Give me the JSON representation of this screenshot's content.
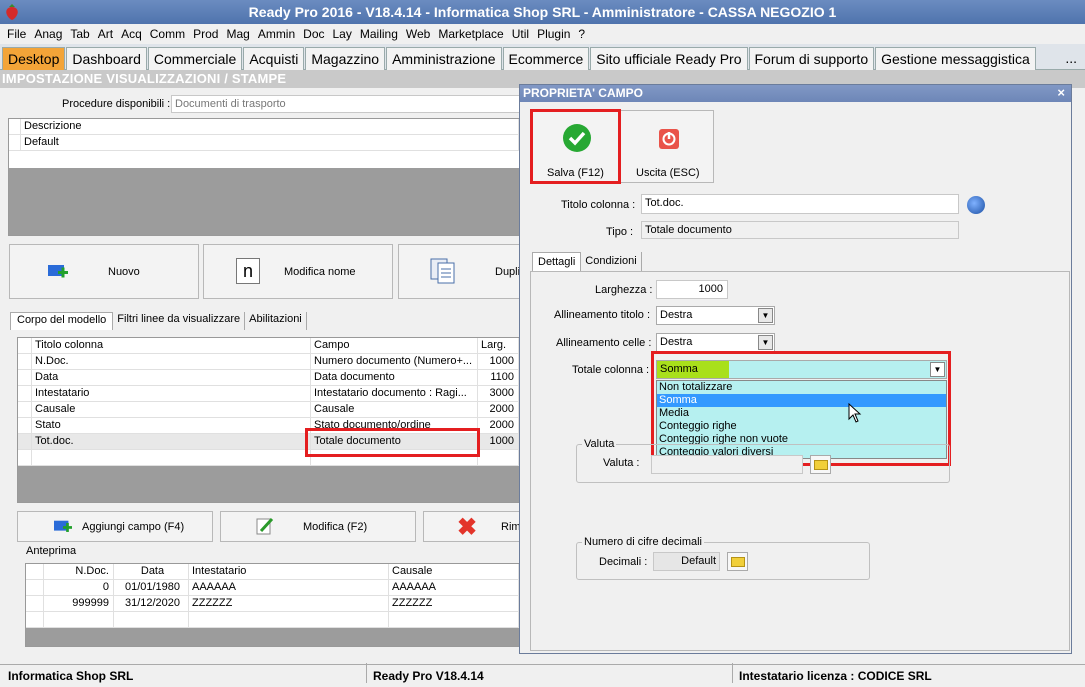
{
  "window": {
    "title": "Ready Pro 2016 - V18.4.14 - Informatica Shop SRL - Amministratore - CASSA NEGOZIO 1"
  },
  "menu": [
    "File",
    "Anag",
    "Tab",
    "Art",
    "Acq",
    "Comm",
    "Prod",
    "Mag",
    "Ammin",
    "Doc",
    "Lay",
    "Mailing",
    "Web",
    "Marketplace",
    "Util",
    "Plugin",
    "?"
  ],
  "tabs": [
    "Desktop",
    "Dashboard",
    "Commerciale",
    "Acquisti",
    "Magazzino",
    "Amministrazione",
    "Ecommerce",
    "Sito ufficiale Ready Pro",
    "Forum di supporto",
    "Gestione messaggistica"
  ],
  "tab_more": "...",
  "section_title": "IMPOSTAZIONE VISUALIZZAZIONI / STAMPE",
  "procedure": {
    "label": "Procedure disponibili :",
    "value": "Documenti di trasporto"
  },
  "models": {
    "header": "Descrizione",
    "rows": [
      "Default"
    ]
  },
  "model_buttons": {
    "new": "Nuovo",
    "rename": "Modifica nome",
    "duplicate": "Dupli"
  },
  "subtabs": [
    "Corpo del modello",
    "Filtri linee da visualizzare",
    "Abilitazioni"
  ],
  "columns_grid": {
    "headers": [
      "Titolo colonna",
      "Campo",
      "Larg."
    ],
    "rows": [
      [
        "N.Doc.",
        "Numero documento (Numero+...",
        "1000"
      ],
      [
        "Data",
        "Data documento",
        "1100"
      ],
      [
        "Intestatario",
        "Intestatario documento : Ragi...",
        "3000"
      ],
      [
        "Causale",
        "Causale",
        "2000"
      ],
      [
        "Stato",
        "Stato documento/ordine",
        "2000"
      ],
      [
        "Tot.doc.",
        "Totale documento",
        "1000"
      ]
    ]
  },
  "field_buttons": {
    "add": "Aggiungi campo (F4)",
    "edit": "Modifica (F2)",
    "remove": "Rimu"
  },
  "preview": {
    "label": "Anteprima",
    "headers": [
      "N.Doc.",
      "Data",
      "Intestatario",
      "Causale"
    ],
    "rows": [
      [
        "0",
        "01/01/1980",
        "AAAAAA",
        "AAAAAA"
      ],
      [
        "999999",
        "31/12/2020",
        "ZZZZZZ",
        "ZZZZZZ"
      ]
    ]
  },
  "dialog": {
    "title": "PROPRIETA' CAMPO",
    "close": "×",
    "save_label": "Salva (F12)",
    "exit_label": "Uscita (ESC)",
    "titolo_label": "Titolo colonna :",
    "titolo_value": "Tot.doc.",
    "tipo_label": "Tipo :",
    "tipo_value": "Totale documento",
    "tabs": [
      "Dettagli",
      "Condizioni"
    ],
    "larghezza_label": "Larghezza :",
    "larghezza_value": "1000",
    "allin_titolo_label": "Allineamento titolo :",
    "allin_titolo_value": "Destra",
    "allin_celle_label": "Allineamento celle :",
    "allin_celle_value": "Destra",
    "totale_label": "Totale colonna :",
    "totale_value": "Somma",
    "totale_options": [
      "Non totalizzare",
      "Somma",
      "Media",
      "Conteggio righe",
      "Conteggio righe non vuote",
      "Conteggio valori diversi"
    ],
    "totale_selected": "Somma",
    "valuta_group": "Valuta",
    "valuta_label": "Valuta :",
    "decimali_group": "Numero di cifre decimali",
    "decimali_label": "Decimali :",
    "decimali_value": "Default"
  },
  "status": {
    "left": "Informatica Shop SRL",
    "mid": "Ready Pro V18.4.14",
    "right": "Intestatario licenza : CODICE SRL"
  },
  "colors": {
    "highlight": "#e41e20",
    "selected": "#3399ff",
    "dropdown_bg": "#b6f0f0",
    "active_tab": "#f3a438"
  }
}
